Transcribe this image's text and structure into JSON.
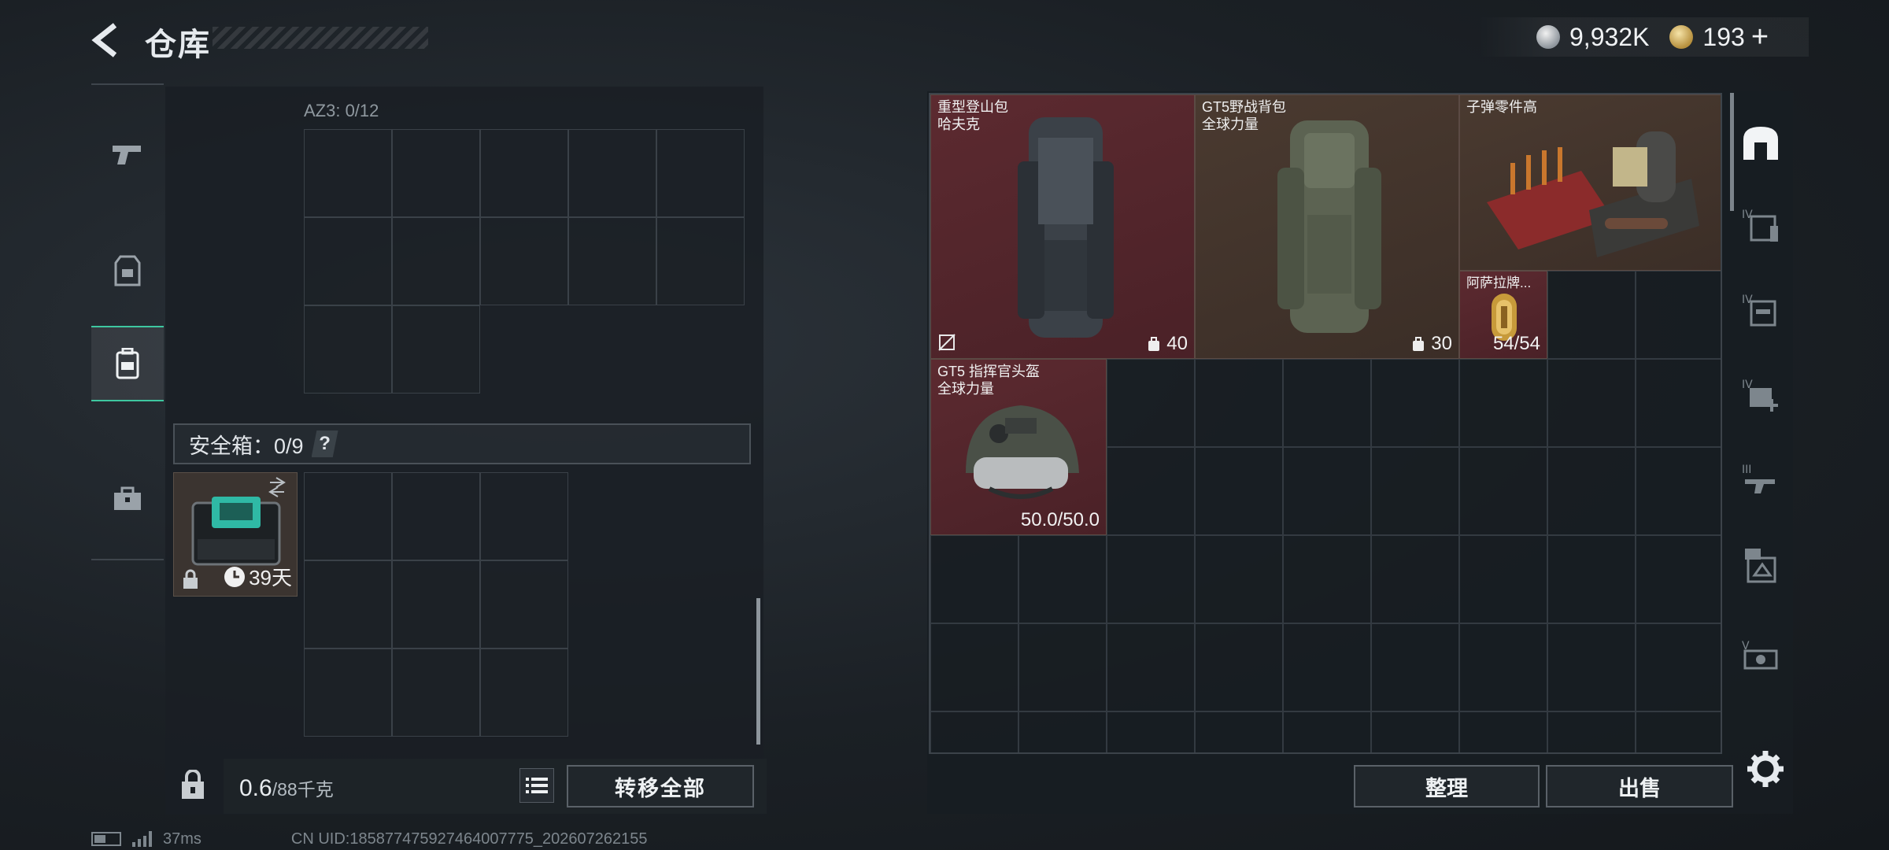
{
  "header": {
    "title": "仓库",
    "currency_silver": "9,932K",
    "currency_gold": "193",
    "add_symbol": "+"
  },
  "storage": {
    "container_label": "AZ3: 0/12",
    "safebox_label": "安全箱：0/9",
    "safebox_help": "?",
    "safebox_item_days": "39天",
    "weight_value": "0.6",
    "weight_unit": "/88千克",
    "transfer_all_label": "转移全部"
  },
  "inventory": {
    "items": [
      {
        "name_line1": "重型登山包",
        "name_line2": "哈夫克",
        "stat": "40",
        "rarity": "red"
      },
      {
        "name_line1": "GT5野战背包",
        "name_line2": "全球力量",
        "stat": "30",
        "rarity": "brown"
      },
      {
        "name_line1": "子弹零件高",
        "name_line2": "",
        "stat": "",
        "rarity": "brown"
      },
      {
        "name_line1": "阿萨拉牌...",
        "name_line2": "",
        "stat": "54/54",
        "rarity": "red"
      },
      {
        "name_line1": "GT5 指挥官头盔",
        "name_line2": "全球力量",
        "stat": "50.0/50.0",
        "rarity": "red"
      }
    ],
    "sort_label": "整理",
    "sell_label": "出售"
  },
  "status_bar": {
    "ping": "37ms",
    "uid": "CN UID:1858774759274640077​75_202607262155"
  },
  "colors": {
    "accent": "#3ec7a0",
    "item_red": "#5c2a30",
    "item_brown": "#4a3a30",
    "panel_bg": "#1a1f24"
  },
  "icons": {
    "back": "back-arrow-icon",
    "weapon": "pistol-icon",
    "armor": "vest-icon",
    "backpack": "backpack-icon",
    "case": "briefcase-icon",
    "settings": "gear-icon"
  }
}
